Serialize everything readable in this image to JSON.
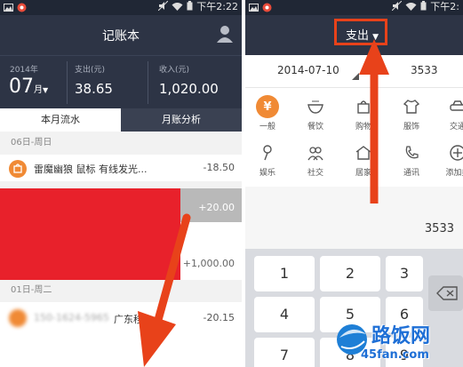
{
  "status": {
    "left_time": "下午2:22",
    "right_time": "下午2:"
  },
  "left": {
    "title": "记账本",
    "summary": {
      "year": "2014年",
      "month_num": "07",
      "month_unit": "月",
      "expense_label": "支出(元)",
      "expense_value": "38.65",
      "income_label": "收入(元)",
      "income_value": "1,020.00"
    },
    "tabs": [
      "本月流水",
      "月账分析"
    ],
    "day1": "06日-周日",
    "item1": {
      "text": "雷魔幽狼 鼠标 有线发光...",
      "amount": "-18.50"
    },
    "amount_plus1": "+20.00",
    "amount_plus2": "+1,000.00",
    "day2": "01日-周二",
    "item2": {
      "text_masked": "150-1624-5965",
      "text": "广东移",
      "amount": "-20.15"
    }
  },
  "right": {
    "dropdown": "支出",
    "date": "2014-07-10",
    "amount_top": "3533",
    "categories": [
      {
        "label": "一般",
        "icon": "yen-icon",
        "color": "#f08a35"
      },
      {
        "label": "餐饮",
        "icon": "bowl-icon",
        "color": "#ffffff"
      },
      {
        "label": "购物",
        "icon": "bag-icon",
        "color": "#ffffff"
      },
      {
        "label": "服饰",
        "icon": "shirt-icon",
        "color": "#ffffff"
      },
      {
        "label": "交通",
        "icon": "car-icon",
        "color": "#ffffff"
      },
      {
        "label": "娱乐",
        "icon": "mic-icon",
        "color": "#ffffff"
      },
      {
        "label": "社交",
        "icon": "people-icon",
        "color": "#ffffff"
      },
      {
        "label": "居家",
        "icon": "home-icon",
        "color": "#ffffff"
      },
      {
        "label": "通讯",
        "icon": "phone-icon",
        "color": "#ffffff"
      },
      {
        "label": "添加类",
        "icon": "plus-icon",
        "color": "#ffffff"
      }
    ],
    "amount_input": "3533",
    "keys": [
      "1",
      "2",
      "3",
      "4",
      "5",
      "6",
      "7",
      "8",
      "9"
    ]
  },
  "watermark": {
    "main": "路饭网",
    "url": "45fan.com"
  },
  "colors": {
    "dark": "#2d3445",
    "accent": "#f08a35",
    "highlight": "#e8421a",
    "censor": "#e8212b"
  }
}
